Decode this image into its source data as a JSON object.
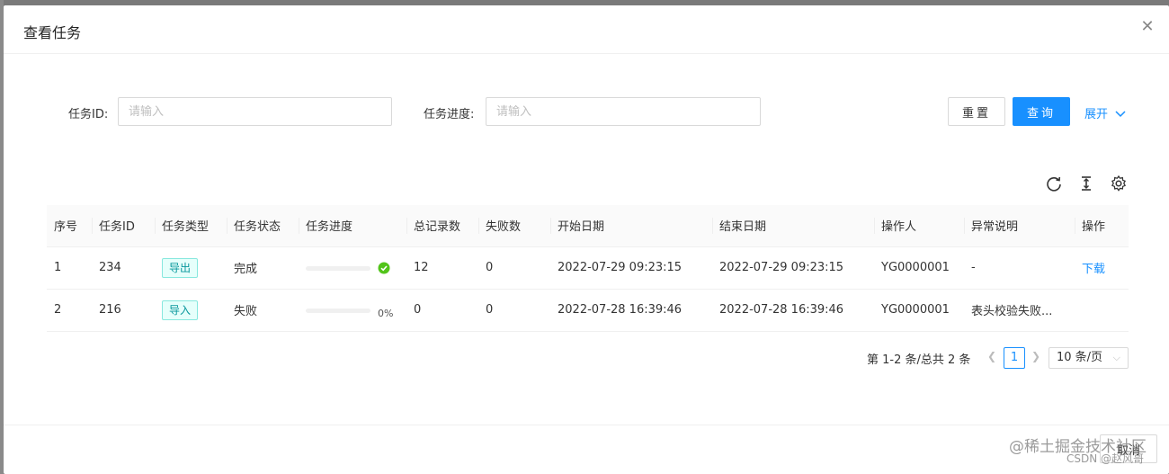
{
  "modal": {
    "title": "查看任务",
    "close_glyph": "✕"
  },
  "filters": {
    "task_id_label": "任务ID:",
    "task_id_placeholder": "请输入",
    "progress_label": "任务进度:",
    "progress_placeholder": "请输入",
    "reset_label": "重置",
    "query_label": "查询",
    "expand_label": "展开"
  },
  "toolbar": {
    "icons": [
      "reload-icon",
      "column-height-icon",
      "setting-icon"
    ]
  },
  "table": {
    "columns": [
      "序号",
      "任务ID",
      "任务类型",
      "任务状态",
      "任务进度",
      "总记录数",
      "失败数",
      "开始日期",
      "结束日期",
      "操作人",
      "异常说明",
      "操作"
    ],
    "rows": [
      {
        "index": "1",
        "task_id": "234",
        "type": "导出",
        "status": "完成",
        "progress": 100,
        "progress_text": "",
        "total": "12",
        "failed": "0",
        "start": "2022-07-29 09:23:15",
        "end": "2022-07-29 09:23:15",
        "operator": "YG0000001",
        "error": "-",
        "action": "下载"
      },
      {
        "index": "2",
        "task_id": "216",
        "type": "导入",
        "status": "失败",
        "progress": 0,
        "progress_text": "0%",
        "total": "0",
        "failed": "0",
        "start": "2022-07-28 16:39:46",
        "end": "2022-07-28 16:39:46",
        "operator": "YG0000001",
        "error": "表头校验失败...",
        "action": ""
      }
    ]
  },
  "pagination": {
    "total_text": "第 1-2 条/总共 2 条",
    "current_page": "1",
    "page_size": "10 条/页"
  },
  "footer": {
    "cancel_label": "取消"
  },
  "watermark": {
    "line1": "@稀土掘金技术社区",
    "line2": "CSDN @赵风哥"
  },
  "colors": {
    "primary": "#1890ff",
    "success": "#52c41a",
    "tag_text": "#08979c"
  }
}
